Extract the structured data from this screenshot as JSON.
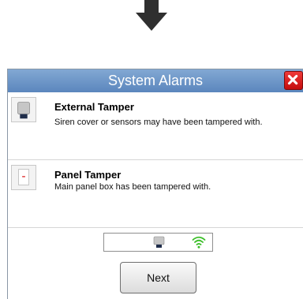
{
  "dialog": {
    "title": "System Alarms",
    "alarms": [
      {
        "title": "External Tamper",
        "description": "Siren cover or sensors may have been tampered with."
      },
      {
        "title": "Panel Tamper",
        "description": "Main panel box has been tampered with."
      }
    ],
    "next_label": "Next"
  },
  "colors": {
    "title_bar": "#6f97c9",
    "close_button": "#e02020",
    "signal": "#3cbf2a"
  },
  "icons": [
    "down-arrow-icon",
    "close-icon",
    "siren-icon",
    "panel-icon",
    "wifi-signal-icon"
  ]
}
